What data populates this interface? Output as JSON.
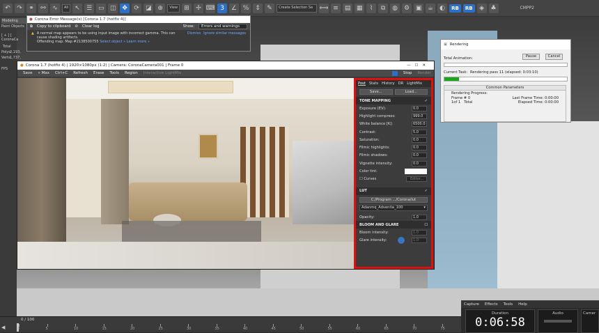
{
  "toolbar": {
    "filter_select": "All",
    "view_select": "View",
    "selection_set": "Create Selection Se",
    "rb1": "RB",
    "rb2": "RB",
    "layer": "CMPP2"
  },
  "left": {
    "tab_modeling": "Modeling",
    "tab_paint": "Paint Objects",
    "scene_label": "[ + ] [ CoronaCa",
    "total": "Total",
    "polys_label": "Polys:",
    "polys": "2,193,",
    "verts_label": "Verts:",
    "verts": "1,737,",
    "fps": "FPS"
  },
  "error_window": {
    "title": "Corona Error Message(s)   [Corona 1.7 (hotfix 4)]",
    "copy": "Copy to clipboard",
    "clear": "Clear log",
    "show_label": "Show:",
    "show_value": "Errors and warnings",
    "msg1": "A normal map appears to be using input image with incorrect gamma. This can",
    "msg2": "cause shading artifacts.",
    "msg3": "Offending map: Map #2138500755",
    "select_link": "Select object »",
    "learn_link": "Learn more »",
    "dismiss": "Dismiss",
    "ignore": "Ignore similar messages"
  },
  "vfb": {
    "title": "Corona 1.7 (hotfix 4) | 1920×1080px (1:2) | Camera: CoronaCamera001 | Frame 0",
    "save": "Save",
    "max": "» Max",
    "ctrlc": "Ctrl+C",
    "refresh": "Refresh",
    "erase": "Erase",
    "tools": "Tools",
    "region": "Region",
    "interactive": "Interactive LightMix",
    "stop": "Stop",
    "render": "Render"
  },
  "post": {
    "tabs": [
      "Post",
      "Stats",
      "History",
      "DR",
      "LightMix"
    ],
    "save": "Save...",
    "load": "Load...",
    "tone_mapping": "TONE MAPPING",
    "exposure_label": "Exposure (EV):",
    "exposure": "0.0",
    "highlight_label": "Highlight compress:",
    "highlight": "999.0",
    "wb_label": "White balance [K]:",
    "wb": "6500.0",
    "contrast_label": "Contrast:",
    "contrast": "5.0",
    "saturation_label": "Saturation:",
    "saturation": "0.0",
    "fhigh_label": "Filmic highlights:",
    "fhigh": "0.0",
    "fshad_label": "Filmic shadows:",
    "fshad": "0.0",
    "vignette_label": "Vignette intensity:",
    "vignette": "0.0",
    "colortint_label": "Color tint:",
    "curves_label": "Curves",
    "editor": "Editor...",
    "lut": "LUT",
    "lut_path": "C:/Program .../Corona/lut",
    "lut_name": "Adanmq_Adventia_100",
    "opacity_label": "Opacity:",
    "opacity": "1.0",
    "bloom": "BLOOM AND GLARE",
    "bloom_label": "Bloom intensity:",
    "bloom_val": "1.0",
    "glare_label": "Glare intensity:",
    "glare_val": "1.0"
  },
  "rendering": {
    "title": "Rendering",
    "pause": "Pause",
    "cancel": "Cancel",
    "total_anim": "Total Animation:",
    "current_task_label": "Current Task:",
    "current_task": "Rendering pass 11 (elapsed: 0:03:10)",
    "progress": 0.12,
    "common": "Common Parameters",
    "progress_label": "Rendering Progress:",
    "frame_label": "Frame #",
    "frame": "0",
    "lastframe_label": "Last Frame Time:",
    "lastframe": "0:00:00",
    "of": "1of 1",
    "total_label": "Total",
    "elapsed_label": "Elapsed Time:",
    "elapsed": "0:00:00"
  },
  "capture": {
    "menu": [
      "Capture",
      "Effects",
      "Tools",
      "Help"
    ],
    "duration_label": "Duration",
    "duration": "0:06:58",
    "audio_label": "Audio",
    "camera_label": "Camer"
  },
  "timeline": {
    "frame": "0 / 100",
    "ticks": [
      "0",
      "5",
      "10",
      "15",
      "20",
      "25",
      "30",
      "35",
      "40",
      "45",
      "50",
      "55",
      "60",
      "65",
      "70",
      "75"
    ]
  }
}
